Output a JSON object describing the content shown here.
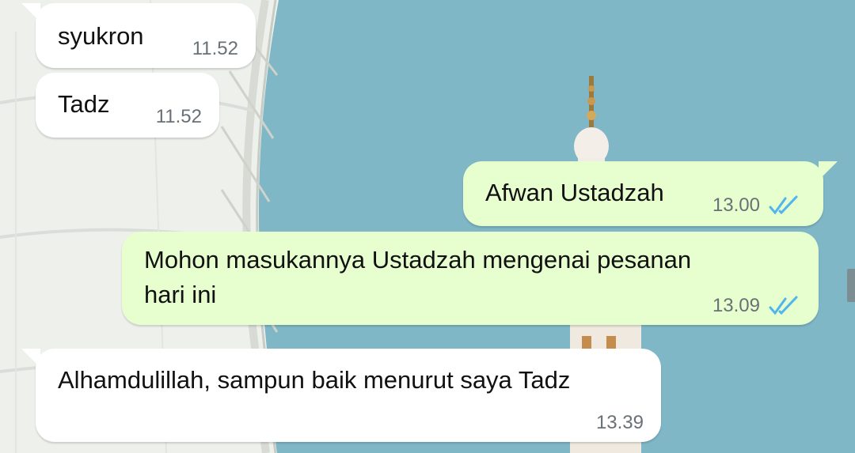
{
  "messages": [
    {
      "direction": "incoming",
      "text": "syukron",
      "time": "11.52"
    },
    {
      "direction": "incoming",
      "text": "Tadz",
      "time": "11.52"
    },
    {
      "direction": "outgoing",
      "text": "Afwan Ustadzah",
      "time": "13.00",
      "status": "read"
    },
    {
      "direction": "outgoing",
      "text_line1": "Mohon masukannya Ustadzah mengenai pesanan",
      "text_line2": "hari ini",
      "time": "13.09",
      "status": "read"
    },
    {
      "direction": "incoming",
      "text": "Alhamdulillah, sampun baik menurut saya Tadz",
      "time": "13.39"
    }
  ],
  "colors": {
    "incoming_bubble": "#ffffff",
    "outgoing_bubble": "#e7fecf",
    "read_ticks": "#4fb6ec",
    "timestamp": "#697177",
    "sky": "#7fb7c6"
  },
  "icons": {
    "read_receipt": "double-check-icon"
  }
}
